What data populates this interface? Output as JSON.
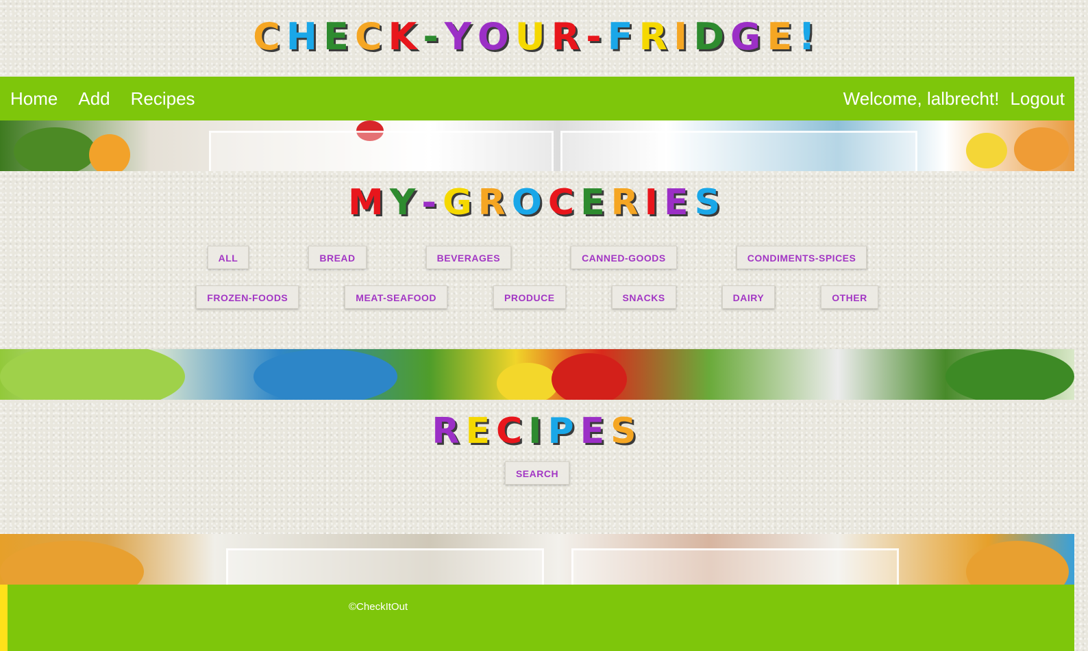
{
  "header": {
    "title_letters": [
      {
        "ch": "C",
        "color": "#f5a623"
      },
      {
        "ch": "H",
        "color": "#1aa7e8"
      },
      {
        "ch": "E",
        "color": "#2e8b2f"
      },
      {
        "ch": "C",
        "color": "#f5a623"
      },
      {
        "ch": "K",
        "color": "#e8161c"
      },
      {
        "ch": "-",
        "color": "#2e8b2f"
      },
      {
        "ch": "Y",
        "color": "#9b2fc6"
      },
      {
        "ch": "O",
        "color": "#9b2fc6"
      },
      {
        "ch": "U",
        "color": "#f5d800"
      },
      {
        "ch": "R",
        "color": "#e8161c"
      },
      {
        "ch": "-",
        "color": "#e8161c"
      },
      {
        "ch": "F",
        "color": "#1aa7e8"
      },
      {
        "ch": "R",
        "color": "#f5d800"
      },
      {
        "ch": "I",
        "color": "#f5a623"
      },
      {
        "ch": "D",
        "color": "#2e8b2f"
      },
      {
        "ch": "G",
        "color": "#9b2fc6"
      },
      {
        "ch": "E",
        "color": "#f5a623"
      },
      {
        "ch": "!",
        "color": "#1aa7e8"
      }
    ]
  },
  "nav": {
    "home": "Home",
    "add": "Add",
    "recipes": "Recipes",
    "welcome": "Welcome, lalbrecht!",
    "logout": "Logout",
    "bar_color": "#7ec60b"
  },
  "groceries": {
    "heading_letters": [
      {
        "ch": "M",
        "color": "#e8161c"
      },
      {
        "ch": "Y",
        "color": "#2e8b2f"
      },
      {
        "ch": "-",
        "color": "#9b2fc6"
      },
      {
        "ch": "G",
        "color": "#f5d800"
      },
      {
        "ch": "R",
        "color": "#f5a623"
      },
      {
        "ch": "O",
        "color": "#1aa7e8"
      },
      {
        "ch": "C",
        "color": "#e8161c"
      },
      {
        "ch": "E",
        "color": "#2e8b2f"
      },
      {
        "ch": "R",
        "color": "#f5a623"
      },
      {
        "ch": "I",
        "color": "#e8161c"
      },
      {
        "ch": "E",
        "color": "#9b2fc6"
      },
      {
        "ch": "S",
        "color": "#1aa7e8"
      }
    ],
    "categories_row_1": [
      "ALL",
      "BREAD",
      "BEVERAGES",
      "CANNED-GOODS",
      "CONDIMENTS-SPICES"
    ],
    "categories_row_2": [
      "FROZEN-FOODS",
      "MEAT-SEAFOOD",
      "PRODUCE",
      "SNACKS",
      "DAIRY",
      "OTHER"
    ]
  },
  "recipes": {
    "heading_letters": [
      {
        "ch": "R",
        "color": "#9b2fc6"
      },
      {
        "ch": "E",
        "color": "#f5d800"
      },
      {
        "ch": "C",
        "color": "#e8161c"
      },
      {
        "ch": "I",
        "color": "#2e8b2f"
      },
      {
        "ch": "P",
        "color": "#1aa7e8"
      },
      {
        "ch": "E",
        "color": "#9b2fc6"
      },
      {
        "ch": "S",
        "color": "#f5a623"
      }
    ],
    "search_label": "SEARCH"
  },
  "footer": {
    "copyright": "©CheckItOut"
  }
}
